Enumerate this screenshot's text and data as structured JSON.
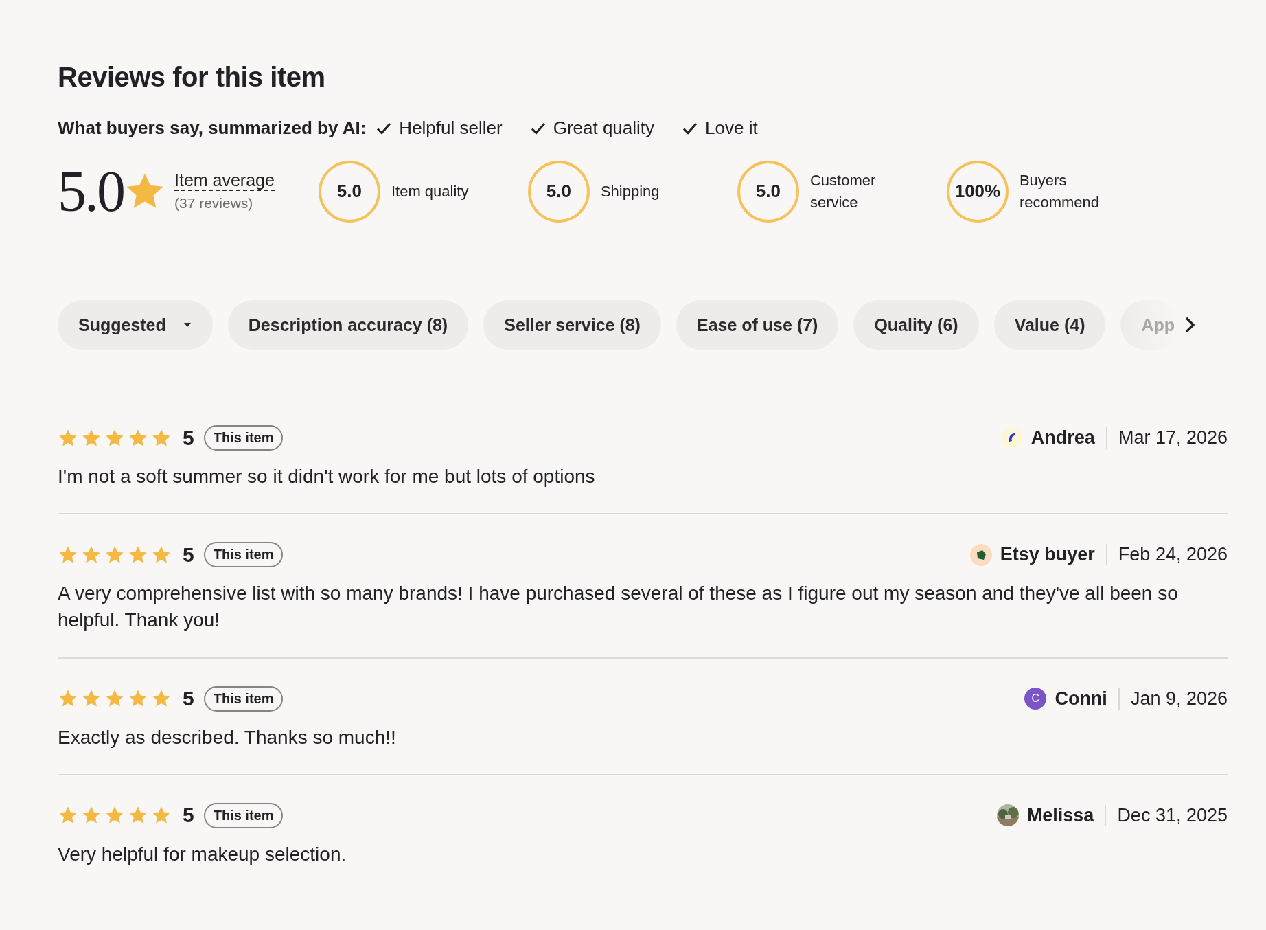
{
  "title": "Reviews for this item",
  "ai_summary": {
    "label": "What buyers say, summarized by AI:",
    "points": [
      "Helpful seller",
      "Great quality",
      "Love it"
    ]
  },
  "average": {
    "score": "5.0",
    "label": "Item average",
    "count": "(37 reviews)"
  },
  "metrics": [
    {
      "value": "5.0",
      "label": "Item quality"
    },
    {
      "value": "5.0",
      "label": "Shipping"
    },
    {
      "value": "5.0",
      "label": "Customer service"
    },
    {
      "value": "100%",
      "label": "Buyers recommend"
    }
  ],
  "filters": [
    {
      "kind": "dropdown",
      "label": "Suggested"
    },
    {
      "kind": "chip",
      "label": "Description accuracy (8)"
    },
    {
      "kind": "chip",
      "label": "Seller service (8)"
    },
    {
      "kind": "chip",
      "label": "Ease of use (7)"
    },
    {
      "kind": "chip",
      "label": "Quality (6)"
    },
    {
      "kind": "chip",
      "label": "Value (4)"
    },
    {
      "kind": "faded",
      "label": "App"
    }
  ],
  "reviews": [
    {
      "stars": 5,
      "rating": "5",
      "tag": "This item",
      "text": "I'm not a soft summer so it didn't work for me but lots of options",
      "name": "Andrea",
      "date": "Mar 17, 2026",
      "avatar": {
        "kind": "swoosh",
        "color": "#2a3bb8"
      }
    },
    {
      "stars": 5,
      "rating": "5",
      "tag": "This item",
      "text": "A very comprehensive list with so many brands! I have purchased several of these as I figure out my season and they've all been so helpful. Thank you!",
      "name": "Etsy buyer",
      "date": "Feb 24, 2026",
      "avatar": {
        "kind": "pentagon",
        "color": "#235c2e"
      }
    },
    {
      "stars": 5,
      "rating": "5",
      "tag": "This item",
      "text": "Exactly as described. Thanks so much!!",
      "name": "Conni",
      "date": "Jan 9, 2026",
      "avatar": {
        "kind": "letter",
        "color": "#7b55c7",
        "letter": "C"
      }
    },
    {
      "stars": 5,
      "rating": "5",
      "tag": "This item",
      "text": "Very helpful for makeup selection.",
      "name": "Melissa",
      "date": "Dec 31, 2025"
    }
  ]
}
